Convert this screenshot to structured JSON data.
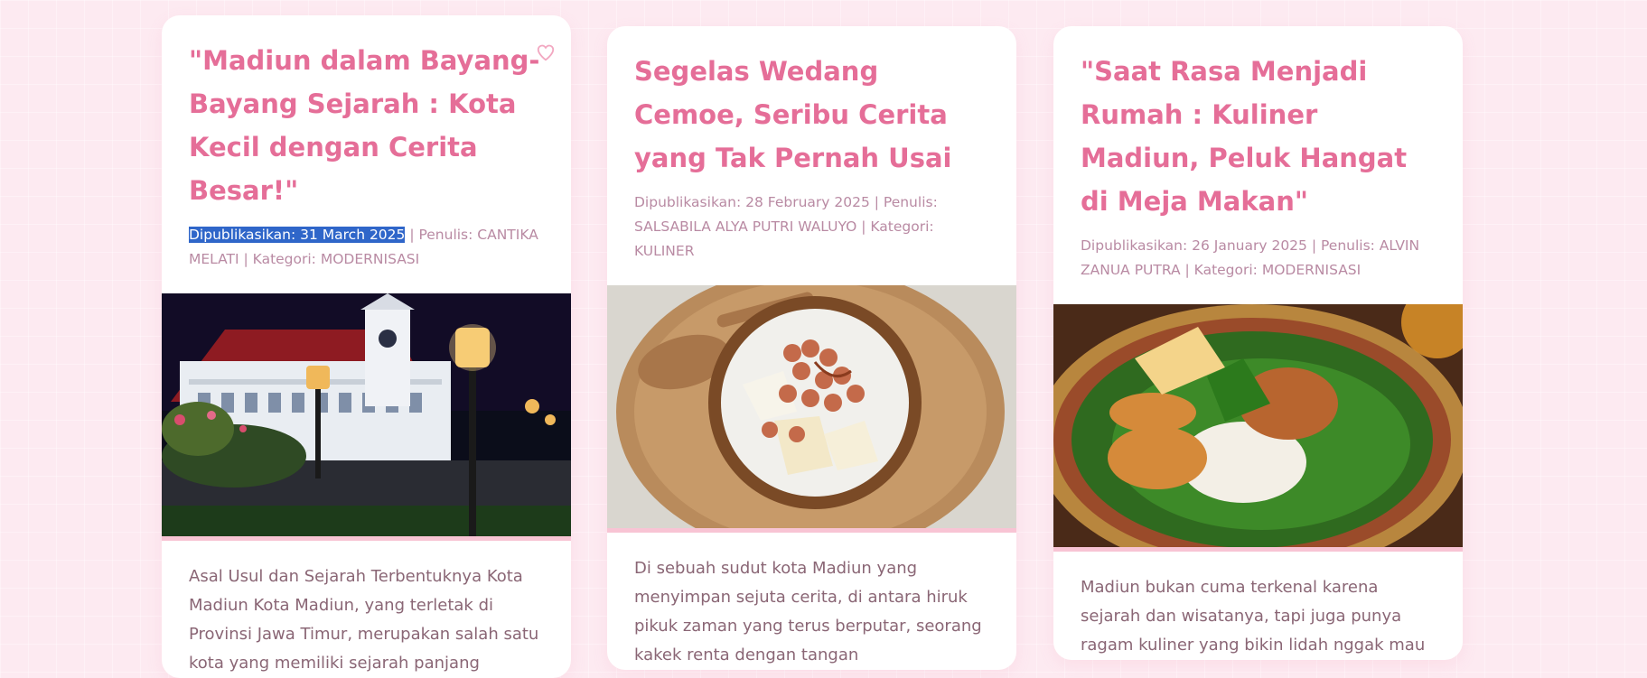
{
  "articles": [
    {
      "title": "\"Madiun dalam Bayang-Bayang Sejarah : Kota Kecil dengan Cerita Besar!\"",
      "date": "Dipublikasikan: 31 March 2025",
      "author_category": " | Penulis: CANTIKA MELATI | Kategori: MODERNISASI",
      "image": "madiun-town-hall-night",
      "excerpt": "Asal Usul dan Sejarah Terbentuknya Kota Madiun Kota Madiun, yang terletak di Provinsi Jawa Timur, merupakan salah satu kota yang memiliki sejarah panjang",
      "favorite_icon": "heart-outline-icon"
    },
    {
      "title": "Segelas Wedang Cemoe, Seribu Cerita yang Tak Pernah Usai",
      "date": "Dipublikasikan: 28 February 2025",
      "author_category": " | Penulis: SALSABILA ALYA PUTRI WALUYO | Kategori: KULINER",
      "image": "wedang-cemoe-bowl",
      "excerpt": "Di sebuah sudut kota Madiun yang menyimpan sejuta cerita, di antara hiruk pikuk zaman yang terus berputar, seorang kakek renta dengan tangan"
    },
    {
      "title": "\"Saat Rasa Menjadi Rumah : Kuliner Madiun, Peluk Hangat di Meja Makan\"",
      "date": "Dipublikasikan: 26 January 2025",
      "author_category": " | Penulis: ALVIN ZANUA PUTRA | Kategori: MODERNISASI",
      "image": "pecel-madiun-plate",
      "excerpt": "Madiun bukan cuma terkenal karena sejarah dan wisatanya, tapi juga punya ragam kuliner yang bikin lidah nggak mau"
    }
  ],
  "colors": {
    "accent": "#e56e98",
    "meta": "#b98aa3",
    "body": "#8a6675",
    "background": "#fdeaf1",
    "selection": "#2f66c9"
  }
}
